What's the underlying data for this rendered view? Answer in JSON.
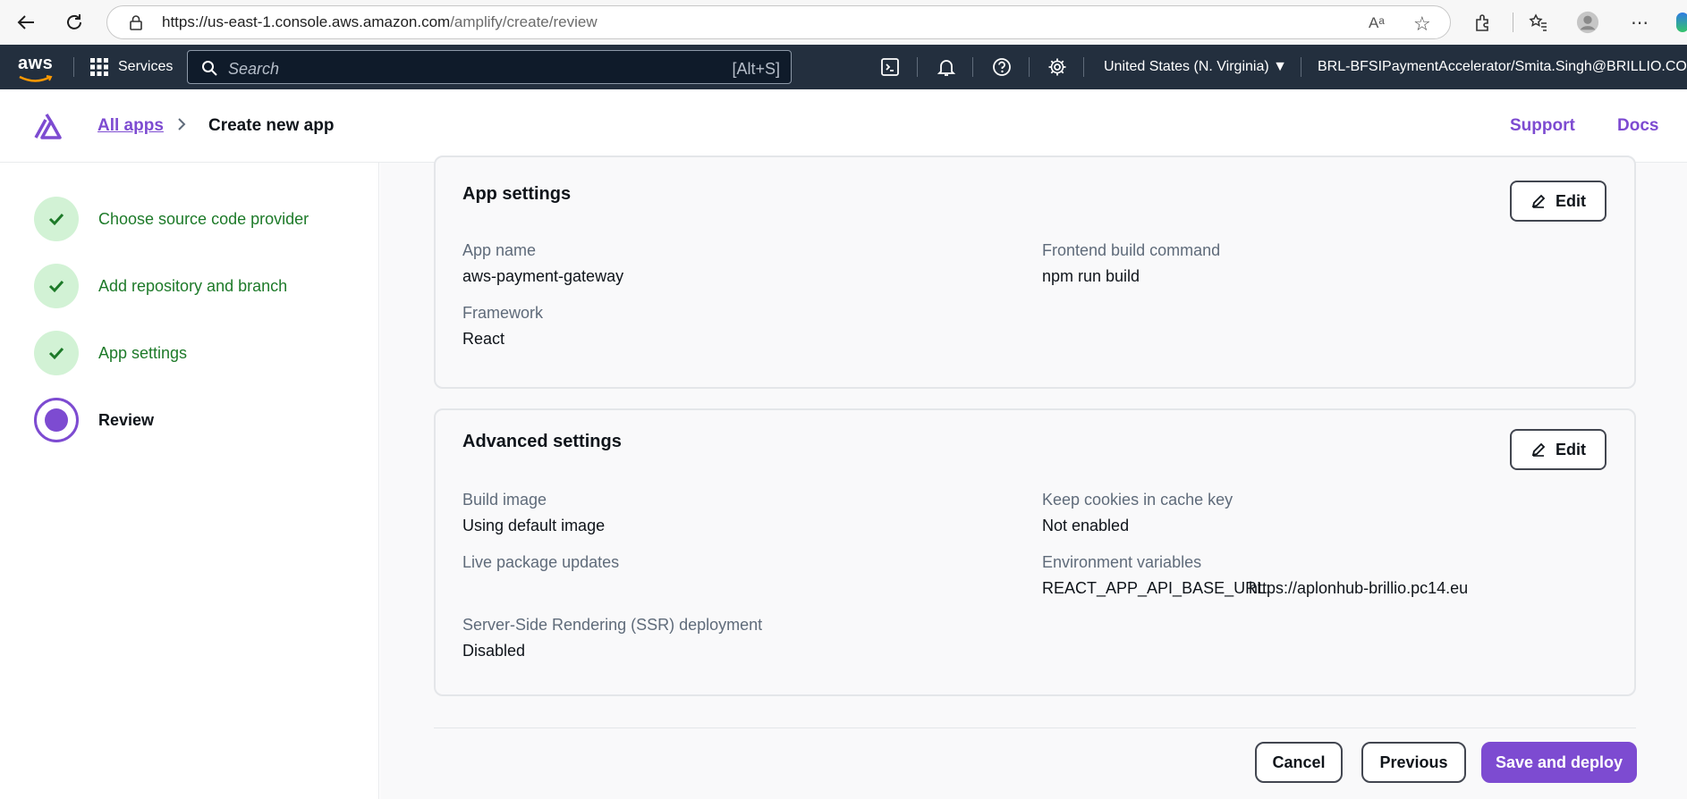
{
  "browser": {
    "url_host": "https://us-east-1.console.aws.amazon.com",
    "url_path": "/amplify/create/review"
  },
  "aws_nav": {
    "logo_text": "aws",
    "services_label": "Services",
    "search_placeholder": "Search",
    "search_shortcut": "[Alt+S]",
    "region": "United States (N. Virginia)",
    "account": "BRL-BFSIPaymentAccelerator/Smita.Singh@BRILLIO.COM"
  },
  "header": {
    "breadcrumb_link": "All apps",
    "breadcrumb_sep": ">",
    "breadcrumb_current": "Create new app",
    "support": "Support",
    "docs": "Docs"
  },
  "steps": [
    {
      "label": "Choose source code provider",
      "status": "complete"
    },
    {
      "label": "Add repository and branch",
      "status": "complete"
    },
    {
      "label": "App settings",
      "status": "complete"
    },
    {
      "label": "Review",
      "status": "current"
    }
  ],
  "app_settings": {
    "title": "App settings",
    "edit": "Edit",
    "app_name_label": "App name",
    "app_name_value": "aws-payment-gateway",
    "build_cmd_label": "Frontend build command",
    "build_cmd_value": "npm run build",
    "framework_label": "Framework",
    "framework_value": "React"
  },
  "advanced_settings": {
    "title": "Advanced settings",
    "edit": "Edit",
    "build_image_label": "Build image",
    "build_image_value": "Using default image",
    "cookies_label": "Keep cookies in cache key",
    "cookies_value": "Not enabled",
    "live_pkg_label": "Live package updates",
    "env_label": "Environment variables",
    "env_key": "REACT_APP_API_BASE_URL:",
    "env_value": "https://aplonhub-brillio.pc14.eu",
    "ssr_label": "Server-Side Rendering (SSR) deployment",
    "ssr_value": "Disabled"
  },
  "actions": {
    "cancel": "Cancel",
    "previous": "Previous",
    "save": "Save and deploy"
  },
  "colors": {
    "accent": "#7d4bd1",
    "success": "#1d7a29",
    "nav_bg": "#232f3e"
  }
}
